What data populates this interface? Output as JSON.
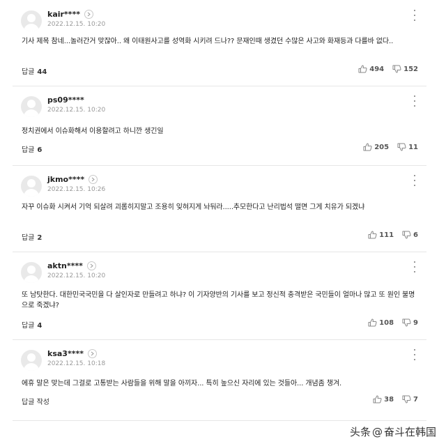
{
  "comments": [
    {
      "nickname": "kair****",
      "date": "2022.12.15. 10:20",
      "text": "기사 제목 참네...놀러간거 맞잖아.. 왜 이태원사고를 성역화 시키려 드나?? 문재인때 생겼던 수많은 사고와 화재등과 다를바 없다..",
      "reply_label": "답글",
      "reply_count": "44",
      "likes": "494",
      "dislikes": "152"
    },
    {
      "nickname": "ps09****",
      "date": "2022.12.15. 10:20",
      "text": "정치권에서 이슈화해서 이용할려고 하니깐 생긴일",
      "reply_label": "답글",
      "reply_count": "6",
      "likes": "205",
      "dislikes": "11"
    },
    {
      "nickname": "jkmo****",
      "date": "2022.12.15. 10:26",
      "text": "자꾸 이슈화 시켜서 기억 되살려 괴롭히지말고 조용히 잊혀지게 놔둬라.....추모한다고 난리법석 떨면 그게 치유가 되겠냐",
      "reply_label": "답글",
      "reply_count": "2",
      "likes": "111",
      "dislikes": "6"
    },
    {
      "nickname": "aktn****",
      "date": "2022.12.15. 10:20",
      "text": "또 남탓한다. 대한민국국민을 다 살인자로 만들려고 하냐? 이 기자양반의 기사를 보고 정신적 충격받은 국민들이 얼마나 많고 또 원인 불명으로 죽겠냐?",
      "reply_label": "답글",
      "reply_count": "4",
      "likes": "108",
      "dislikes": "9"
    },
    {
      "nickname": "ksa3****",
      "date": "2022.12.15. 10:18",
      "text": "에휴 말은 맞는데 그걸로 고통받는 사람들을 위해 말을 아끼자... 특히 높으신 자리에 있는 것들아... 개념좀 챙겨.",
      "reply_label": "답글 작성",
      "reply_count": "",
      "likes": "38",
      "dislikes": "7"
    }
  ],
  "watermark": {
    "source": "头条",
    "at": "@",
    "handle": "奋斗在韩国"
  },
  "colors": {
    "divider": "#e6e6e6",
    "meta": "#999999",
    "text": "#222222"
  }
}
